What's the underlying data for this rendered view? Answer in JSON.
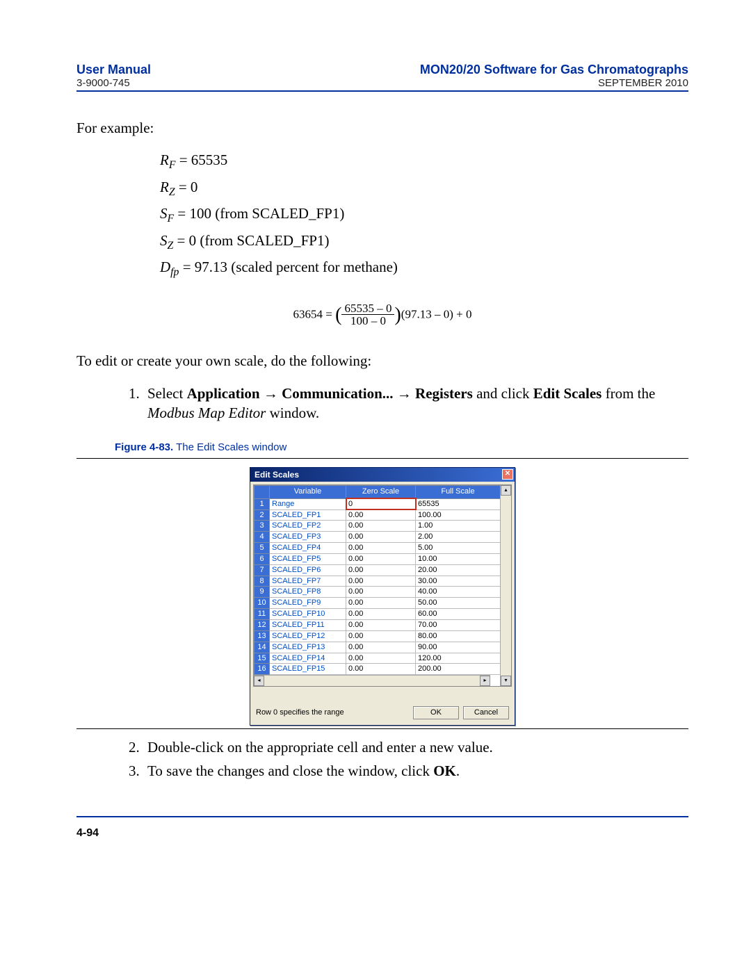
{
  "header": {
    "left_top": "User Manual",
    "left_sub": "3-9000-745",
    "right_top": "MON20/20 Software for Gas Chromatographs",
    "right_sub": "SEPTEMBER 2010"
  },
  "text": {
    "for_example": "For example:",
    "rf_lhs": "R",
    "rf_sub": "F",
    "rf_rhs": " = 65535",
    "rz_lhs": "R",
    "rz_sub": "Z",
    "rz_rhs": " = 0",
    "sf_lhs": "S",
    "sf_sub": "F",
    "sf_rhs": " = 100 (from SCALED_FP1)",
    "sz_lhs": "S",
    "sz_sub": "Z",
    "sz_rhs": " = 0 (from SCALED_FP1)",
    "dfp_lhs": "D",
    "dfp_sub": "fp",
    "dfp_rhs": " = 97.13 (scaled percent for methane)",
    "formula_left": "63654 = ",
    "formula_num": "65535 – 0",
    "formula_den": "100 – 0",
    "formula_right": "(97.13 – 0) + 0",
    "to_edit": "To edit or create your own scale, do the following:",
    "step1_pre": "Select ",
    "step1_b1": "Application",
    "step1_arrow1": " → ",
    "step1_b2": "Communication...",
    "step1_arrow2": " → ",
    "step1_b3": "Registers",
    "step1_mid": " and click ",
    "step1_b4": "Edit Scales",
    "step1_post1": " from the ",
    "step1_ital": "Modbus Map Editor",
    "step1_post2": " window.",
    "step2": "Double-click on the appropriate cell and enter a new value.",
    "step3_pre": "To save the changes and close the window, click ",
    "step3_b": "OK",
    "step3_post": "."
  },
  "figure": {
    "label": "Figure 4-83.",
    "caption": "  The Edit Scales window"
  },
  "dialog": {
    "title": "Edit Scales",
    "close": "✕",
    "columns": [
      "Variable",
      "Zero Scale",
      "Full Scale"
    ],
    "rows": [
      {
        "n": "1",
        "var": "Range",
        "zero": "0",
        "full": "65535"
      },
      {
        "n": "2",
        "var": "SCALED_FP1",
        "zero": "0.00",
        "full": "100.00"
      },
      {
        "n": "3",
        "var": "SCALED_FP2",
        "zero": "0.00",
        "full": "1.00"
      },
      {
        "n": "4",
        "var": "SCALED_FP3",
        "zero": "0.00",
        "full": "2.00"
      },
      {
        "n": "5",
        "var": "SCALED_FP4",
        "zero": "0.00",
        "full": "5.00"
      },
      {
        "n": "6",
        "var": "SCALED_FP5",
        "zero": "0.00",
        "full": "10.00"
      },
      {
        "n": "7",
        "var": "SCALED_FP6",
        "zero": "0.00",
        "full": "20.00"
      },
      {
        "n": "8",
        "var": "SCALED_FP7",
        "zero": "0.00",
        "full": "30.00"
      },
      {
        "n": "9",
        "var": "SCALED_FP8",
        "zero": "0.00",
        "full": "40.00"
      },
      {
        "n": "10",
        "var": "SCALED_FP9",
        "zero": "0.00",
        "full": "50.00"
      },
      {
        "n": "11",
        "var": "SCALED_FP10",
        "zero": "0.00",
        "full": "60.00"
      },
      {
        "n": "12",
        "var": "SCALED_FP11",
        "zero": "0.00",
        "full": "70.00"
      },
      {
        "n": "13",
        "var": "SCALED_FP12",
        "zero": "0.00",
        "full": "80.00"
      },
      {
        "n": "14",
        "var": "SCALED_FP13",
        "zero": "0.00",
        "full": "90.00"
      },
      {
        "n": "15",
        "var": "SCALED_FP14",
        "zero": "0.00",
        "full": "120.00"
      },
      {
        "n": "16",
        "var": "SCALED_FP15",
        "zero": "0.00",
        "full": "200.00"
      }
    ],
    "status": "Row 0 specifies the range",
    "ok": "OK",
    "cancel": "Cancel",
    "scroll_up": "▴",
    "scroll_down": "▾",
    "scroll_left": "◂",
    "scroll_right": "▸"
  },
  "footer": {
    "page": "4-94"
  }
}
